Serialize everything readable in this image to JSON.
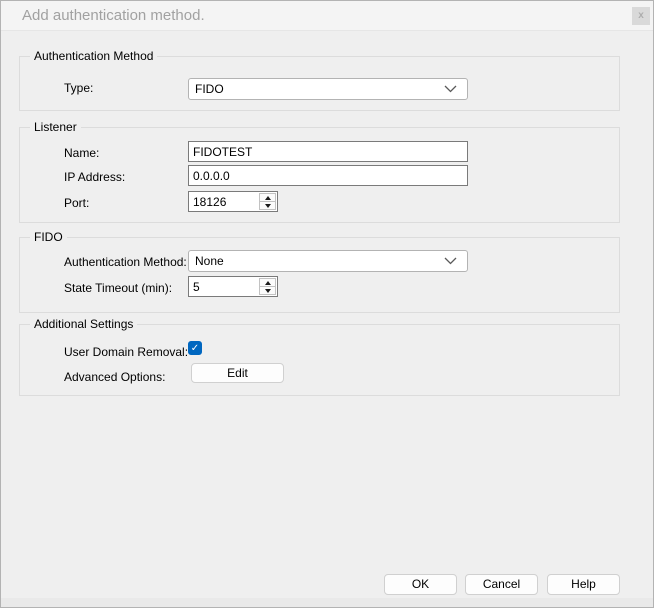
{
  "window": {
    "title": "Add authentication method."
  },
  "icons": {
    "close": "x",
    "check": "✓"
  },
  "groups": {
    "authentication_method": {
      "title": "Authentication Method",
      "type_label": "Type:",
      "type_value": "FIDO"
    },
    "listener": {
      "title": "Listener",
      "name_label": "Name:",
      "name_value": "FIDOTEST",
      "ip_label": "IP Address:",
      "ip_value": "0.0.0.0",
      "port_label": "Port:",
      "port_value": "18126"
    },
    "fido": {
      "title": "FIDO",
      "auth_method_label": "Authentication Method:",
      "auth_method_value": "None",
      "state_timeout_label": "State Timeout (min):",
      "state_timeout_value": "5"
    },
    "additional_settings": {
      "title": "Additional Settings",
      "user_domain_removal_label": "User Domain Removal:",
      "user_domain_removal_checked": true,
      "advanced_options_label": "Advanced Options:",
      "edit_button_label": "Edit"
    }
  },
  "footer": {
    "ok_label": "OK",
    "cancel_label": "Cancel",
    "help_label": "Help"
  },
  "colors": {
    "accent": "#0067c0",
    "titlebar_bg": "#f4f4f4",
    "body_bg": "#efefef",
    "group_border": "#dcdcdc",
    "input_border": "#7a7a7a",
    "button_border": "#d0d0d0",
    "title_text": "#a1a1a1"
  }
}
